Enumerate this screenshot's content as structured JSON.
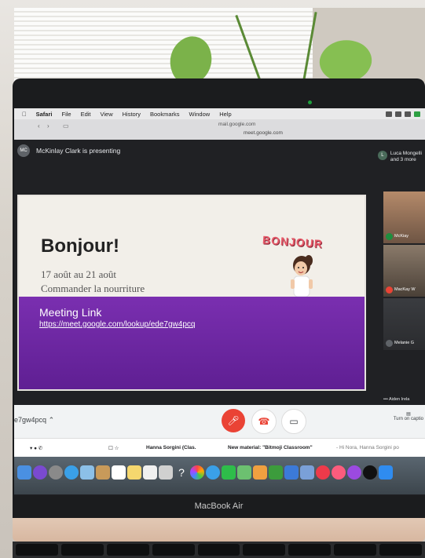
{
  "menubar": {
    "app": "Safari",
    "items": [
      "File",
      "Edit",
      "View",
      "History",
      "Bookmarks",
      "Window",
      "Help"
    ]
  },
  "browser": {
    "url_top": "mail.google.com",
    "url_bottom": "meet.google.com"
  },
  "meet": {
    "presenter_initials": "MC",
    "presenter_text": "McKinlay Clark is presenting",
    "top_right_avatar": "L",
    "top_right_name": "Luca Mongelli",
    "top_right_more": "and 3 more",
    "participants": [
      {
        "name": "McKiay",
        "mic": "on"
      },
      {
        "name": "MacKay W",
        "mic": "muted"
      },
      {
        "name": "Melanie G",
        "mic": "on"
      }
    ],
    "more_tile_label": "Aiden Irela",
    "meeting_code": "e7gw4pcq",
    "captions_label": "Turn on captio"
  },
  "slide": {
    "title": "Bonjour!",
    "date_line": "17 août au 21 août",
    "subtitle_line": "Commander la nourriture",
    "bitmoji_text": "BONJOUR",
    "meeting_link_label": "Meeting Link",
    "meeting_link_url": "https://meet.google.com/lookup/ede7gw4pcq"
  },
  "gmail": {
    "sender": "Hanna Sorgini (Clas.",
    "subject": "New material: \"Bitmoji Classroom\"",
    "snippet": "- Hi Nora, Hanna Sorgini po"
  },
  "laptop": {
    "model": "MacBook Air"
  },
  "colors": {
    "purple": "#6a25a0",
    "meet_bg": "#202124",
    "end_call_red": "#ea4335",
    "bonjour_pink": "#e85a6a"
  }
}
